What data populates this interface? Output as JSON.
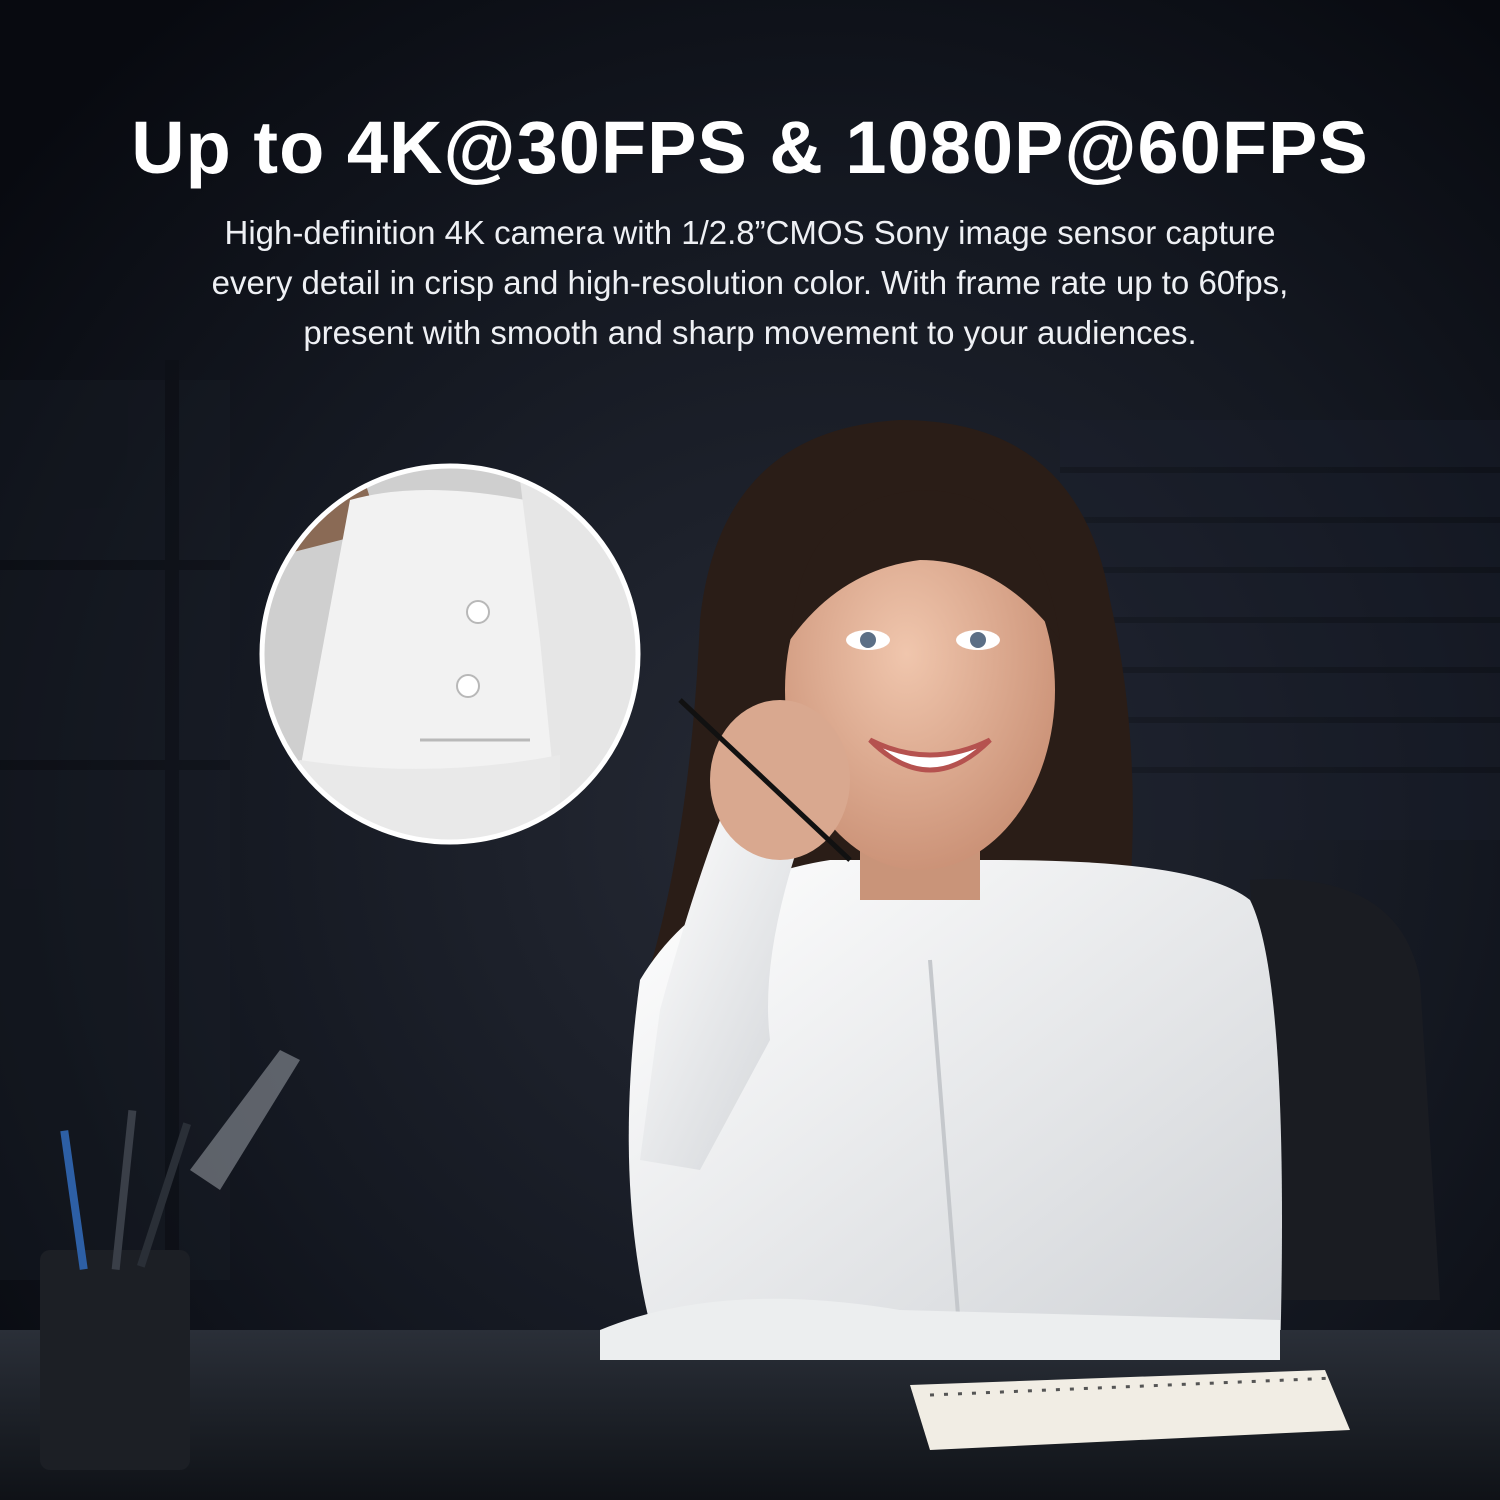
{
  "colors": {
    "background": "#0d1118",
    "headline": "#ffffff",
    "subtitle": "#eef0f4",
    "shirt": "#f4f4f2",
    "hair": "#2a1d17",
    "skin": "#d9a88f",
    "desk": "#1a1e24"
  },
  "text": {
    "headline": "Up to 4K@30FPS & 1080P@60FPS",
    "subtitle": "High-definition 4K camera with 1/2.8”CMOS Sony image sensor capture\nevery detail in crisp and high-resolution color. With frame rate up to 60fps,\npresent with smooth and sharp movement to your audiences."
  },
  "photo": {
    "subject": "smiling woman in white shirt at desk",
    "inset": "magnified shirt cuff with two buttons"
  }
}
